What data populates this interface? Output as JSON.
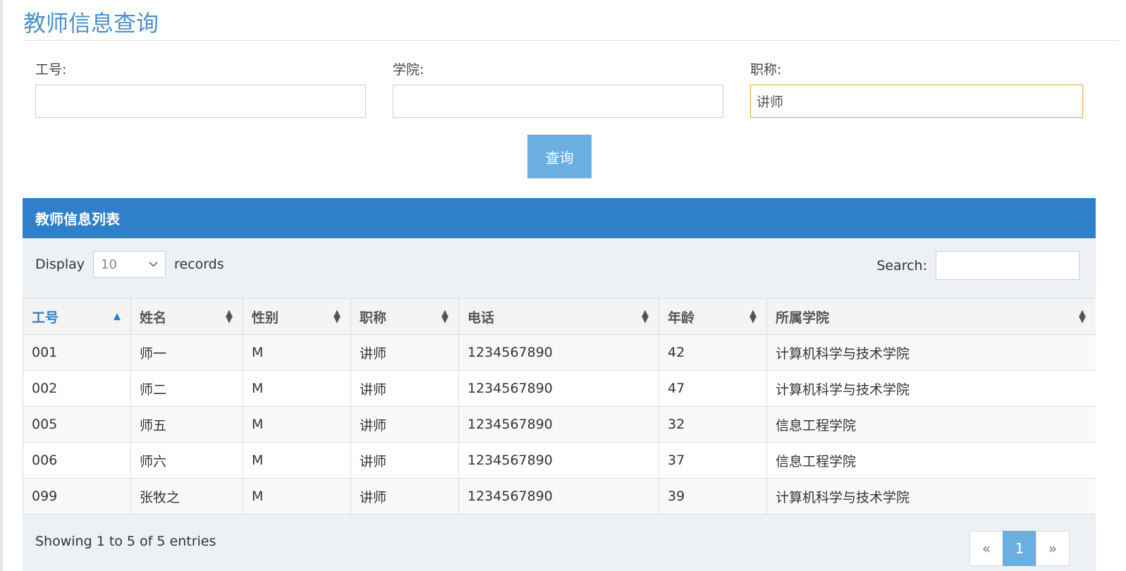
{
  "page_title": "教师信息查询",
  "form": {
    "id_label": "工号:",
    "id_value": "",
    "college_label": "学院:",
    "college_value": "",
    "title_label": "职称:",
    "title_value": "讲师",
    "query_button": "查询"
  },
  "panel": {
    "header": "教师信息列表",
    "display_label": "Display",
    "page_length": "10",
    "records_label": "records",
    "search_label": "Search:",
    "search_value": ""
  },
  "table": {
    "columns": [
      "工号",
      "姓名",
      "性别",
      "职称",
      "电话",
      "年龄",
      "所属学院"
    ],
    "rows": [
      [
        "001",
        "师一",
        "M",
        "讲师",
        "1234567890",
        "42",
        "计算机科学与技术学院"
      ],
      [
        "002",
        "师二",
        "M",
        "讲师",
        "1234567890",
        "47",
        "计算机科学与技术学院"
      ],
      [
        "005",
        "师五",
        "M",
        "讲师",
        "1234567890",
        "32",
        "信息工程学院"
      ],
      [
        "006",
        "师六",
        "M",
        "讲师",
        "1234567890",
        "37",
        "信息工程学院"
      ],
      [
        "099",
        "张牧之",
        "M",
        "讲师",
        "1234567890",
        "39",
        "计算机科学与技术学院"
      ]
    ]
  },
  "footer": {
    "info": "Showing 1 to 5 of 5 entries",
    "prev": "«",
    "current_page": "1",
    "next": "»"
  },
  "colors": {
    "accent": "#307fcb",
    "button": "#6aafdf",
    "title": "#4d90c9"
  }
}
